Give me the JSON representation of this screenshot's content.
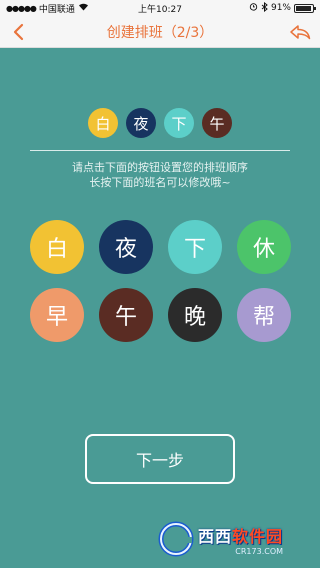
{
  "status_bar": {
    "carrier": "中国联通",
    "time": "上午10:27",
    "battery": "91%",
    "battery_level": 0.91
  },
  "nav": {
    "title": "创建排班（2/3）"
  },
  "sequence": [
    {
      "label": "白",
      "color": "#f2c233"
    },
    {
      "label": "夜",
      "color": "#173460"
    },
    {
      "label": "下",
      "color": "#5ccfc9"
    },
    {
      "label": "午",
      "color": "#5a2c23"
    }
  ],
  "hint": {
    "line1": "请点击下面的按钮设置您的排班顺序",
    "line2": "长按下面的班名可以修改哦~"
  },
  "shifts": [
    {
      "label": "白",
      "color": "#f2c233"
    },
    {
      "label": "夜",
      "color": "#173460"
    },
    {
      "label": "下",
      "color": "#5ccfc9"
    },
    {
      "label": "休",
      "color": "#4cc46a"
    },
    {
      "label": "早",
      "color": "#ef9a6a"
    },
    {
      "label": "午",
      "color": "#5a2c23"
    },
    {
      "label": "晚",
      "color": "#2b2b2b"
    },
    {
      "label": "帮",
      "color": "#a79ad0"
    }
  ],
  "next_button": "下一步",
  "watermark": {
    "main_white": "西西",
    "main_red": "软件园",
    "sub": "CR173.COM"
  }
}
